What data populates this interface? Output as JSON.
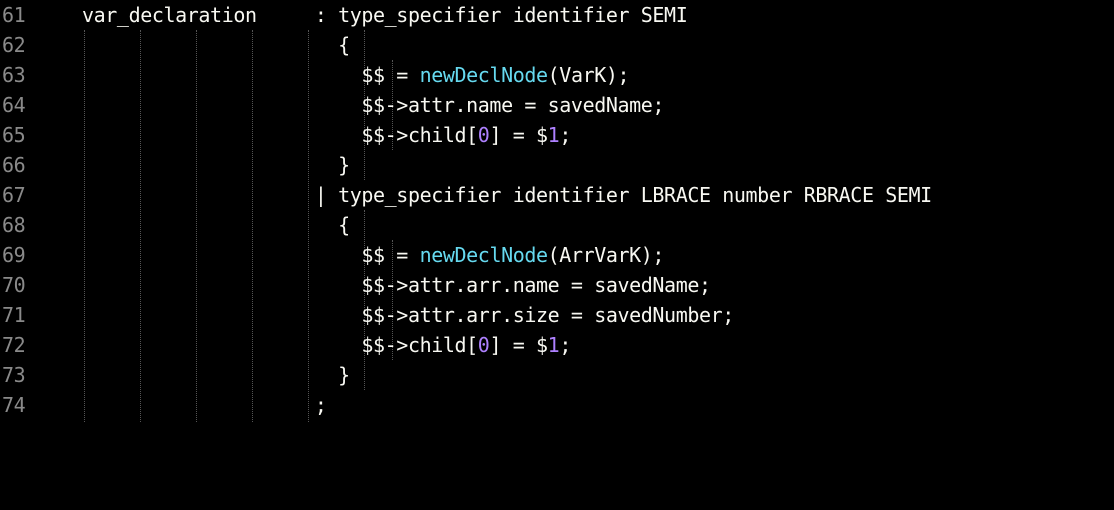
{
  "editor": {
    "lines": [
      {
        "number": "61",
        "text": "var_declaration     : type_specifier identifier SEMI"
      },
      {
        "number": "62",
        "text": "                      {"
      },
      {
        "number": "63",
        "pre": "                        $$ = ",
        "fn": "newDeclNode",
        "post": "(VarK);"
      },
      {
        "number": "64",
        "text": "                        $$->attr.name = savedName;"
      },
      {
        "number": "65",
        "pre": "                        $$->child[",
        "n1": "0",
        "mid": "] = $",
        "n2": "1",
        "post": ";"
      },
      {
        "number": "66",
        "text": "                      }"
      },
      {
        "number": "67",
        "text": "                    | type_specifier identifier LBRACE number RBRACE SEMI"
      },
      {
        "number": "68",
        "text": "                      {"
      },
      {
        "number": "69",
        "pre": "                        $$ = ",
        "fn": "newDeclNode",
        "post": "(ArrVarK);"
      },
      {
        "number": "70",
        "text": "                        $$->attr.arr.name = savedName;"
      },
      {
        "number": "71",
        "text": "                        $$->attr.arr.size = savedNumber;"
      },
      {
        "number": "72",
        "pre": "                        $$->child[",
        "n1": "0",
        "mid": "] = $",
        "n2": "1",
        "post": ";"
      },
      {
        "number": "73",
        "text": "                      }"
      },
      {
        "number": "74",
        "text": "                    ;"
      }
    ]
  },
  "colors": {
    "background": "#000000",
    "text": "#f8f8f2",
    "line_number": "#8a8a8a",
    "function": "#66d9ef",
    "number": "#ae81ff"
  }
}
